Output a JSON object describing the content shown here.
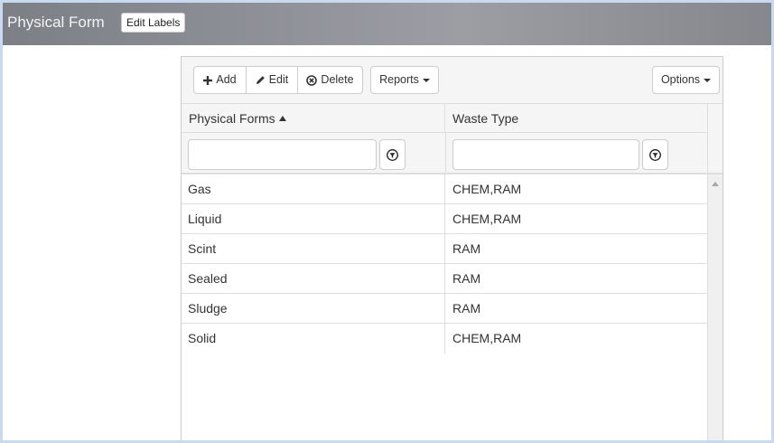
{
  "app": {
    "title": "Physical Form",
    "edit_labels_label": "Edit Labels"
  },
  "toolbar": {
    "add_label": "Add",
    "edit_label": "Edit",
    "delete_label": "Delete",
    "reports_label": "Reports",
    "options_label": "Options"
  },
  "grid": {
    "columns": [
      "Physical Forms",
      "Waste Type"
    ],
    "sort": {
      "column": "Physical Forms",
      "direction": "ascending"
    },
    "filters": [
      "",
      ""
    ],
    "rows": [
      [
        "Gas",
        "CHEM,RAM"
      ],
      [
        "Liquid",
        "CHEM,RAM"
      ],
      [
        "Scint",
        "RAM"
      ],
      [
        "Sealed",
        "RAM"
      ],
      [
        "Sludge",
        "RAM"
      ],
      [
        "Solid",
        "CHEM,RAM"
      ]
    ]
  },
  "icons": {
    "add": "plus-icon",
    "edit": "pencil-icon",
    "delete": "circle-x-icon",
    "filter": "funnel-icon",
    "dropdown": "caret-down-icon",
    "sort": "sort-ascending-icon"
  },
  "colors": {
    "titlebar_gradient": [
      "#7d7f86",
      "#9c9ea4",
      "#85878d"
    ],
    "window_border": "#c9d9ef",
    "header_bg": "#f5f5f5",
    "grid_line": "#dddddd"
  }
}
